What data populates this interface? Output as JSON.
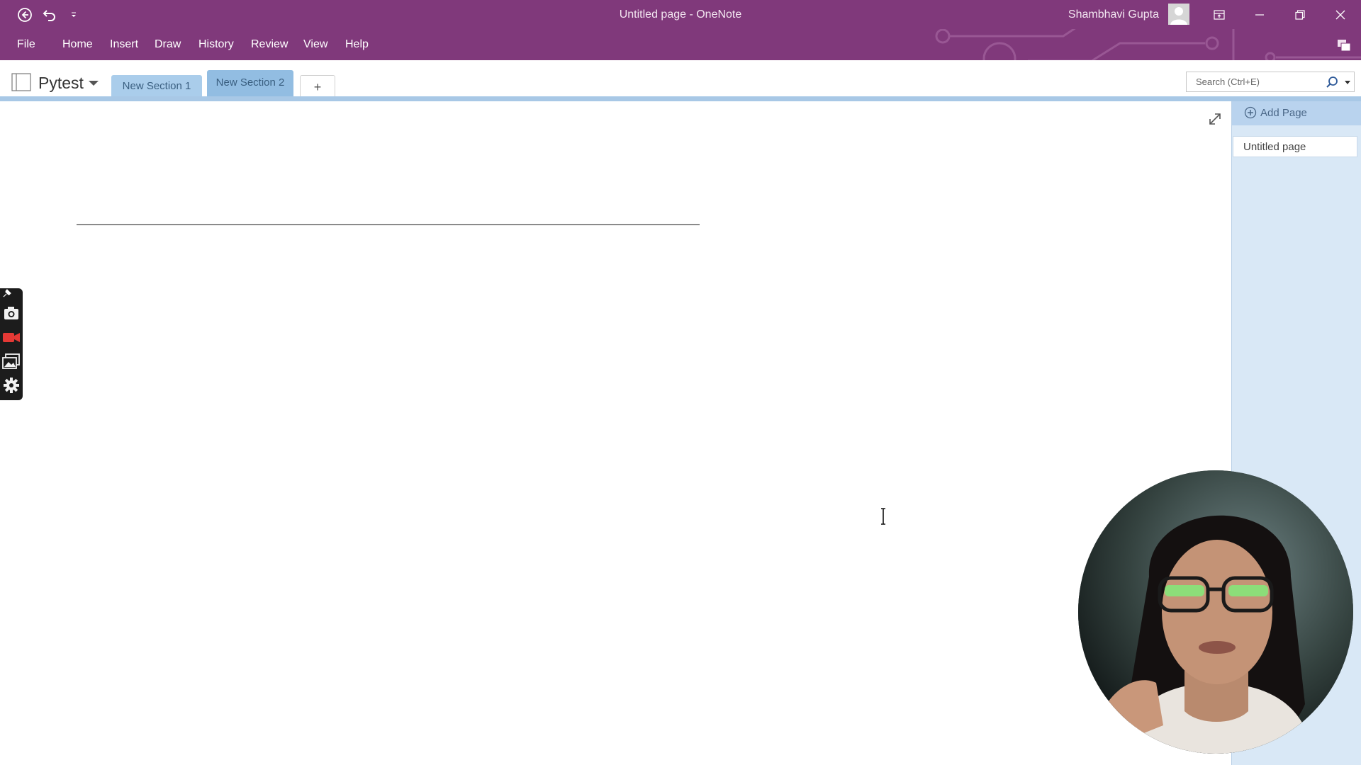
{
  "window": {
    "title": "Untitled page  -  OneNote",
    "user_name": "Shambhavi Gupta",
    "accent_color": "#80397b"
  },
  "quick_access": {
    "icons": [
      "back-icon",
      "undo-icon",
      "customize-icon"
    ]
  },
  "menu": {
    "items": [
      "File",
      "Home",
      "Insert",
      "Draw",
      "History",
      "Review",
      "View",
      "Help"
    ]
  },
  "notebook": {
    "name": "Pytest",
    "sections": [
      {
        "label": "New Section 1",
        "color": "#aacdeb"
      },
      {
        "label": "New Section 2",
        "color": "#92bde2",
        "active": true
      }
    ],
    "add_section_label": "+"
  },
  "search": {
    "placeholder": "Search (Ctrl+E)"
  },
  "pages_pane": {
    "add_page_label": "Add Page",
    "pages": [
      "Untitled page"
    ]
  },
  "recorder_toolbar": {
    "icons": [
      "pin-icon",
      "camera-icon",
      "video-icon",
      "gallery-icon",
      "settings-icon"
    ]
  }
}
